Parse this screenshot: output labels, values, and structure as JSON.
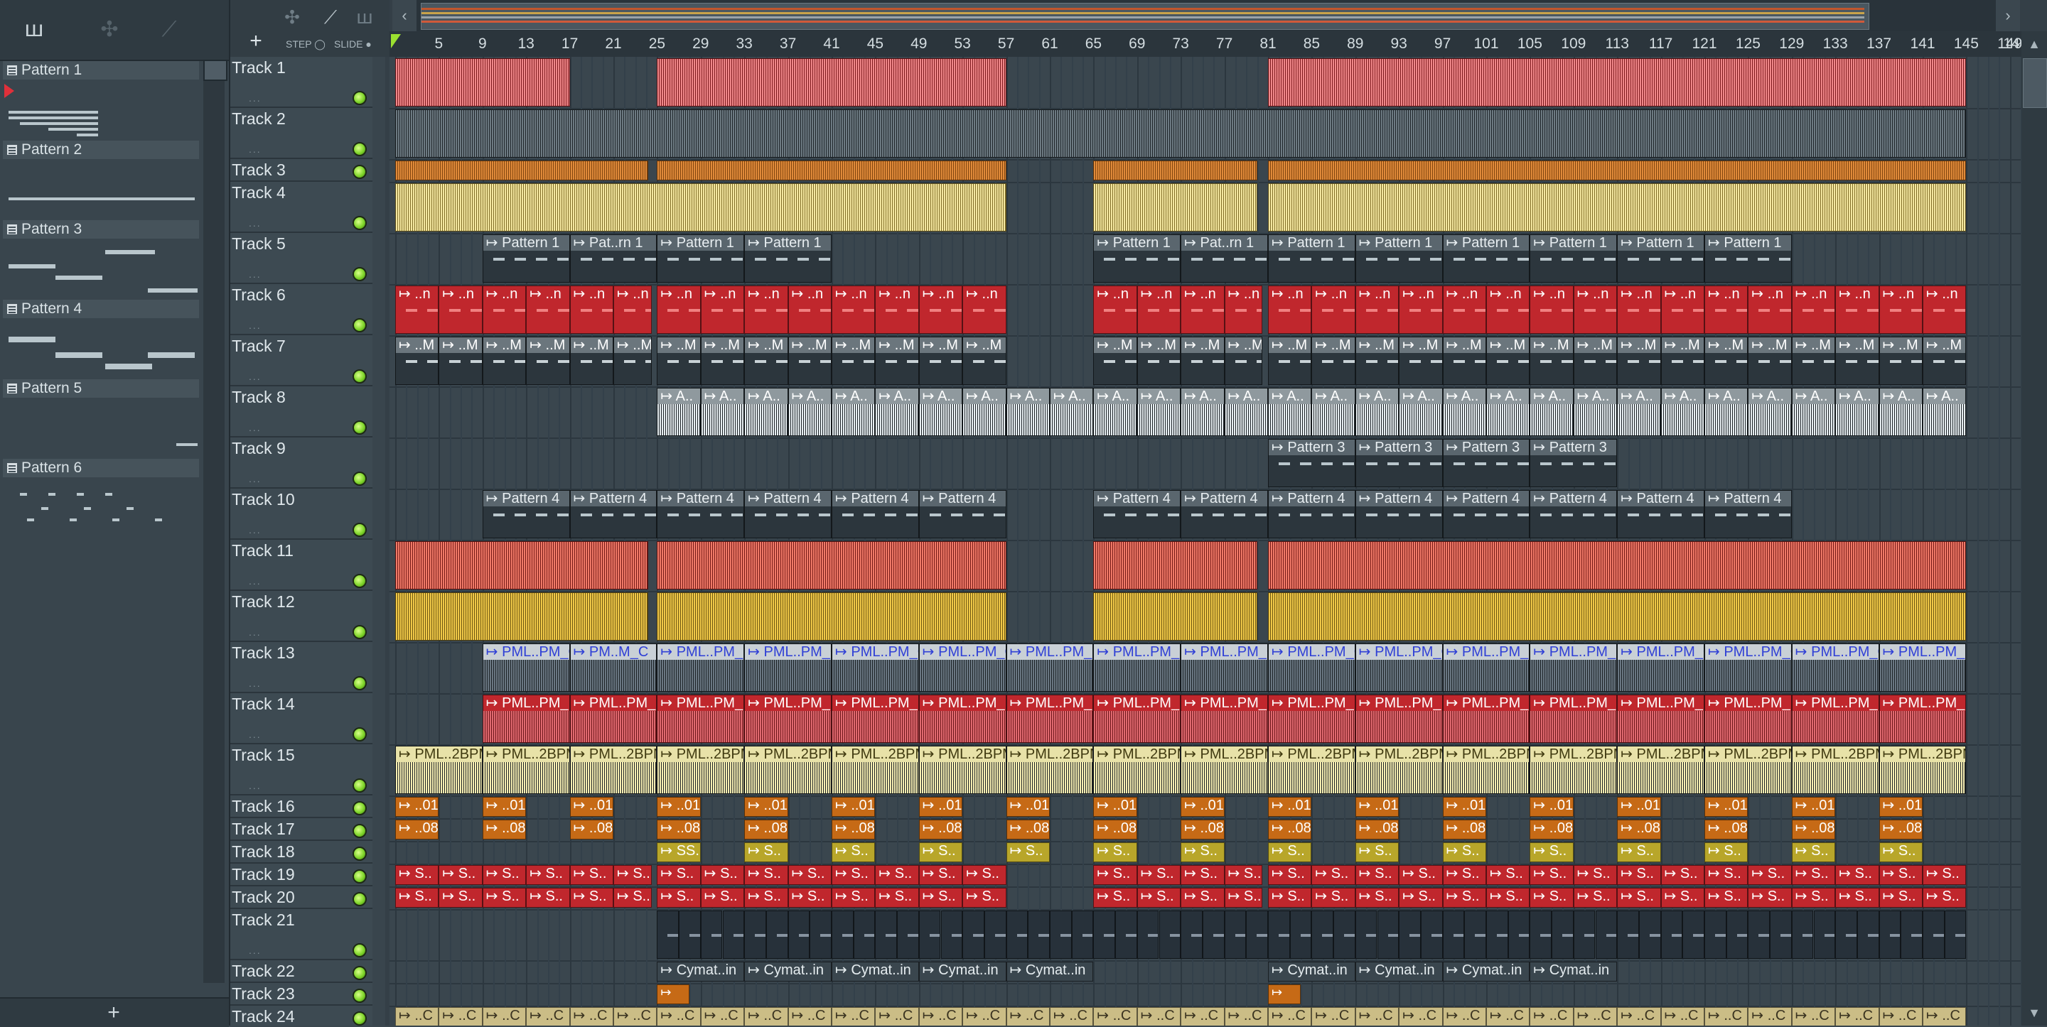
{
  "picker": {
    "patterns": [
      "Pattern 1",
      "Pattern 2",
      "Pattern 3",
      "Pattern 4",
      "Pattern 5",
      "Pattern 6"
    ],
    "add_label": "+"
  },
  "toolbar": {
    "add_label": "+",
    "step_label": "STEP",
    "slide_label": "SLIDE"
  },
  "ruler": {
    "bars": [
      5,
      9,
      13,
      17,
      21,
      25,
      29,
      33,
      37,
      41,
      45,
      49,
      53,
      57,
      61,
      65,
      69,
      73,
      77,
      81,
      85,
      89,
      93,
      97,
      101,
      105,
      109,
      113,
      117,
      121,
      125,
      129,
      133,
      137,
      141,
      145,
      149
    ],
    "last_label": "14"
  },
  "tracks": [
    {
      "name": "Track 1",
      "size": "tall"
    },
    {
      "name": "Track 2",
      "size": "tall"
    },
    {
      "name": "Track 3",
      "size": "small"
    },
    {
      "name": "Track 4",
      "size": "tall"
    },
    {
      "name": "Track 5",
      "size": "tall"
    },
    {
      "name": "Track 6",
      "size": "tall"
    },
    {
      "name": "Track 7",
      "size": "tall"
    },
    {
      "name": "Track 8",
      "size": "tall"
    },
    {
      "name": "Track 9",
      "size": "tall"
    },
    {
      "name": "Track 10",
      "size": "tall"
    },
    {
      "name": "Track 11",
      "size": "tall"
    },
    {
      "name": "Track 12",
      "size": "tall"
    },
    {
      "name": "Track 13",
      "size": "tall"
    },
    {
      "name": "Track 14",
      "size": "tall"
    },
    {
      "name": "Track 15",
      "size": "tall"
    },
    {
      "name": "Track 16",
      "size": "small"
    },
    {
      "name": "Track 17",
      "size": "small"
    },
    {
      "name": "Track 18",
      "size": "small"
    },
    {
      "name": "Track 19",
      "size": "small"
    },
    {
      "name": "Track 20",
      "size": "small"
    },
    {
      "name": "Track 21",
      "size": "tall"
    },
    {
      "name": "Track 22",
      "size": "small"
    },
    {
      "name": "Track 23",
      "size": "small"
    },
    {
      "name": "Track 24",
      "size": "small"
    }
  ],
  "clip_labels": {
    "track5": [
      "Pattern 1",
      "Pat..rn 1",
      "Pattern 1",
      "Pattern 1",
      "Pattern 1",
      "Pat..rn 1",
      "Pattern 1",
      "Pattern 1",
      "Pattern 1",
      "Pattern 1",
      "Pattern 1",
      "Pattern 1"
    ],
    "track6": "..n",
    "track7": "..M",
    "track8": "A..",
    "track9": [
      "Pattern 3",
      "Pattern 3",
      "Pattern 3",
      "Pattern 3"
    ],
    "track10": "Pattern 4",
    "track13": [
      "PML..PM_C",
      "PM..M_C",
      "PML..PM_C"
    ],
    "track14": [
      "PML..PM_E",
      "PML..PM_E",
      "PM..M_E"
    ],
    "track15": [
      "PML..2BPM",
      "PM..BPM"
    ],
    "track16": "..01",
    "track17": "..08",
    "track18": [
      "SS..",
      "S.."
    ],
    "track19": "S..",
    "track20": "S..",
    "track22": "Cymat..in",
    "track24": "..C"
  },
  "colors": {
    "red": "#c0272d",
    "orange": "#c66a16",
    "yellow": "#c6a93e",
    "blue": "#2f3fd6",
    "gray": "#9aa3a8",
    "dark": "#303b42"
  }
}
